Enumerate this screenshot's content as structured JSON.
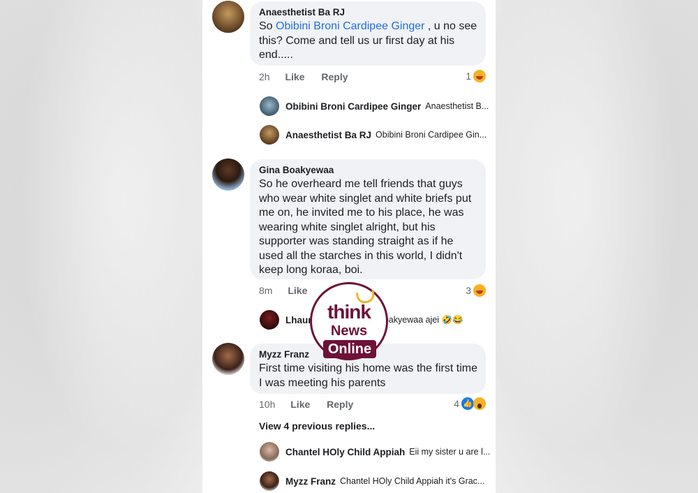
{
  "comments": [
    {
      "author": "Anaesthetist Ba RJ",
      "text_before": "So ",
      "mention": "Obibini Broni Cardipee Ginger",
      "text_after": " , u no see this? Come and tell us ur first day at his end.....",
      "time": "2h",
      "like": "Like",
      "reply": "Reply",
      "reaction_count": "1"
    },
    {
      "author": "Gina Boakyewaa",
      "text": "So he overheard me tell friends that guys who wear white singlet and white briefs put me on, he invited me to his place, he was wearing white singlet alright, but his supporter was standing straight as if he used all the starches in this world, I didn't keep long koraa, boi.",
      "time": "8m",
      "like": "Like",
      "reaction_count": "3"
    },
    {
      "author": "Myzz Franz",
      "text": "First time visiting his home was the first time I was meeting his parents",
      "time": "10h",
      "like": "Like",
      "reply": "Reply",
      "reaction_count": "4"
    }
  ],
  "replies": [
    {
      "name": "Obibini Broni Cardipee Ginger",
      "text": "Anaesthetist B..."
    },
    {
      "name": "Anaesthetist Ba RJ",
      "text": "Obibini Broni Cardipee Gin..."
    },
    {
      "name": "Lhaur",
      "text": "Boakyewaa ajei 🤣😂"
    },
    {
      "name": "Chantel HOly Child Appiah",
      "text": "Eii my sister u are l..."
    },
    {
      "name": "Myzz Franz",
      "text": "Chantel HOly Child Appiah  it's Grac..."
    }
  ],
  "view_previous": "View 4 previous replies...",
  "watermark": {
    "think": "think",
    "news": "News",
    "online": "Online"
  },
  "colors": {
    "mention": "#216fdb",
    "bubble": "#f0f2f5",
    "brand": "#6d1238"
  }
}
